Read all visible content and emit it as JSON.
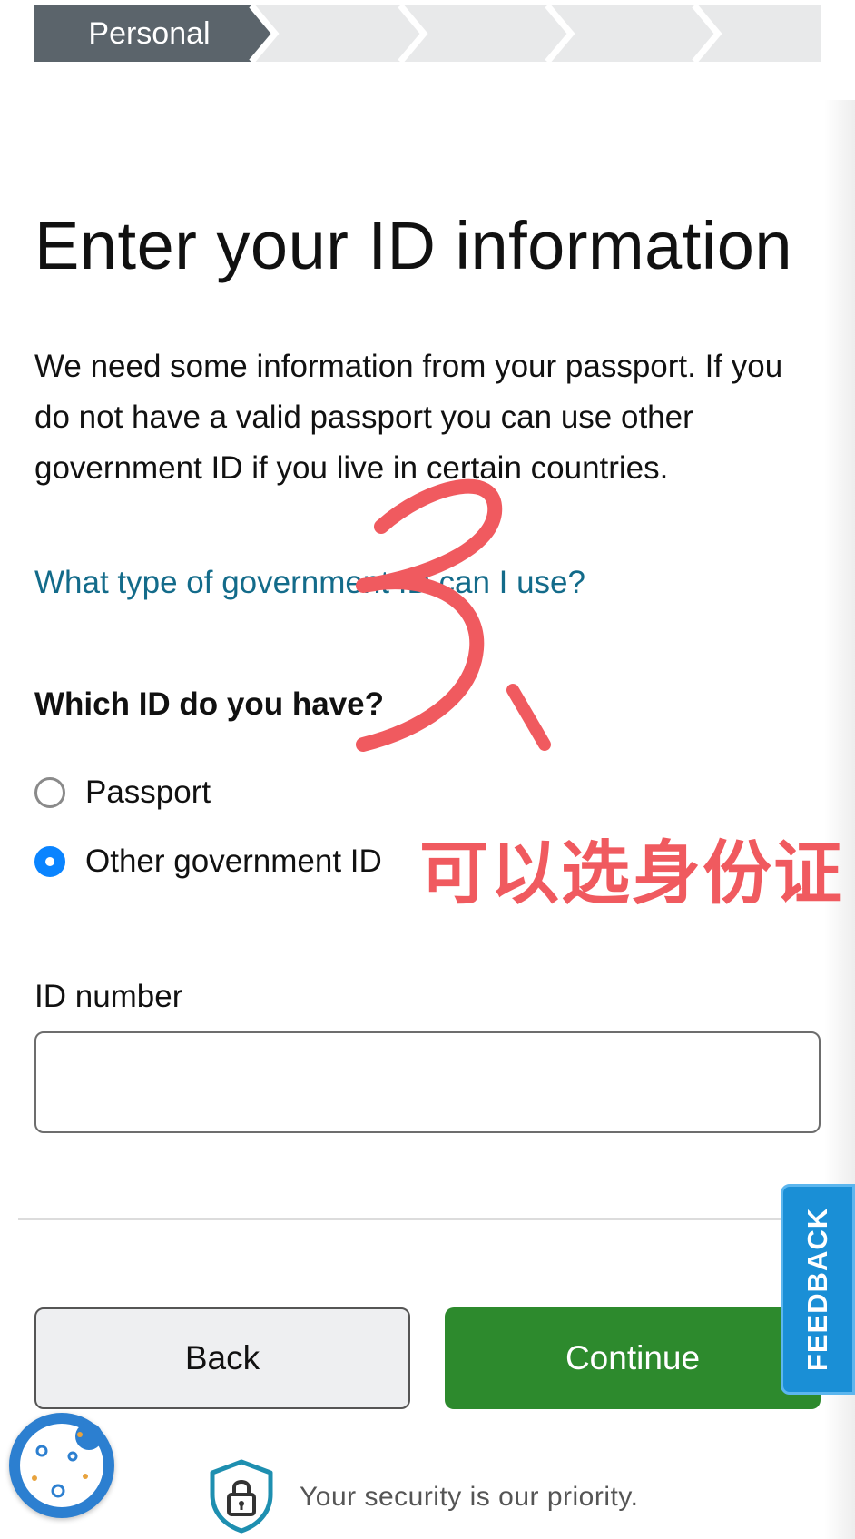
{
  "progress": {
    "steps": [
      "Personal",
      "",
      "",
      "",
      ""
    ],
    "active_index": 0
  },
  "page": {
    "title": "Enter your ID information",
    "intro": "We need some information from your passport. If you do not have a valid passport you can use other government ID if you live in certain countries.",
    "help_link": "What type of government ID can I use?"
  },
  "id_type": {
    "question": "Which ID do you have?",
    "options": [
      {
        "label": "Passport",
        "selected": false
      },
      {
        "label": "Other government ID",
        "selected": true
      }
    ]
  },
  "id_number": {
    "label": "ID number",
    "value": "",
    "placeholder": ""
  },
  "actions": {
    "back_label": "Back",
    "continue_label": "Continue"
  },
  "feedback_tab": {
    "label": "FEEDBACK"
  },
  "footer": {
    "security_text": "Your security is our priority."
  },
  "annotations": {
    "number_mark": "3、",
    "handwritten_note": "可以选身份证"
  },
  "colors": {
    "progress_active": "#5b646b",
    "progress_inactive": "#e8e9ea",
    "link": "#136b8a",
    "radio_selected": "#0a84ff",
    "continue_button": "#2d8a2d",
    "feedback_tab": "#1a8fd6",
    "annotation": "#f05a5f"
  },
  "icons": {
    "cookie_button": "cookie-icon",
    "security": "shield-lock-icon"
  }
}
